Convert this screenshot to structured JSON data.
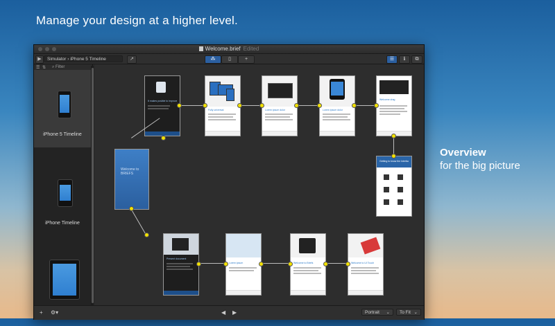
{
  "headline": "Manage your design at a higher level.",
  "overview": {
    "title": "Overview",
    "subtitle": "for the big picture"
  },
  "window": {
    "title": "Welcome.brief",
    "status": "Edited"
  },
  "toolbar": {
    "play_icon": "play-icon",
    "breadcrumb": "Simulator ›  iPhone 5 Timeline",
    "share_icon": "share-icon",
    "view_icons": [
      "storyboard-icon",
      "device-icon",
      "add-icon"
    ],
    "right_icons": [
      "list-icon",
      "info-icon",
      "export-icon"
    ]
  },
  "sidebar": {
    "filter_placeholder": "Filter",
    "items": [
      {
        "label": "iPhone 5 Timeline"
      },
      {
        "label": "iPhone Timeline"
      },
      {
        "label": ""
      }
    ]
  },
  "canvas": {
    "row1": [
      {
        "title": "It makes posible to improve ...",
        "theme": "dark"
      },
      {
        "title": "Fully universal",
        "theme": "light"
      },
      {
        "title": "Lorem ipsum dolor",
        "theme": "light"
      },
      {
        "title": "Lorem ipsum dolor",
        "theme": "light"
      },
      {
        "title": "Welcome drag",
        "theme": "light"
      }
    ],
    "splash": {
      "title": "Welcome to BRIEFS"
    },
    "side_card": {
      "title": "Getting to know the interface"
    },
    "row2": [
      {
        "title": "Present document",
        "theme": "dark"
      },
      {
        "title": "Lorem ipsum",
        "theme": "light"
      },
      {
        "title": "Welcome to Briefs",
        "theme": "light"
      },
      {
        "title": "Welcome to UI Touch",
        "theme": "light"
      }
    ]
  },
  "bottombar": {
    "add_icon": "add-icon",
    "gear_icon": "gear-icon",
    "prev_icon": "prev-icon",
    "next_icon": "next-icon",
    "orientation": "Portrait",
    "zoom": "To Fit"
  }
}
